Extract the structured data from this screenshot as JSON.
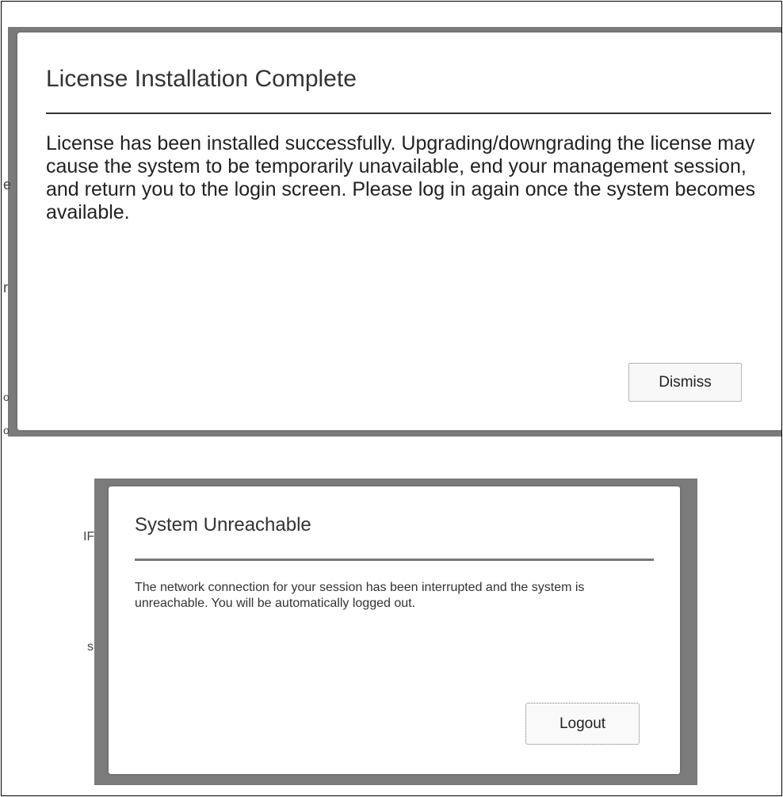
{
  "license_dialog": {
    "title": "License Installation Complete",
    "message": "License has been installed successfully. Upgrading/downgrading the license may cause the system to be temporarily unavailable, end your management session, and return you to the login screen. Please log in again once the system becomes available.",
    "dismiss_label": "Dismiss"
  },
  "unreachable_dialog": {
    "title": "System Unreachable",
    "message": "The network connection for your session has been interrupted and the system is unreachable. You will be automatically logged out.",
    "logout_label": "Logout"
  },
  "background_fragments": [
    "e",
    "r",
    "o",
    "o",
    "IF",
    "s"
  ]
}
